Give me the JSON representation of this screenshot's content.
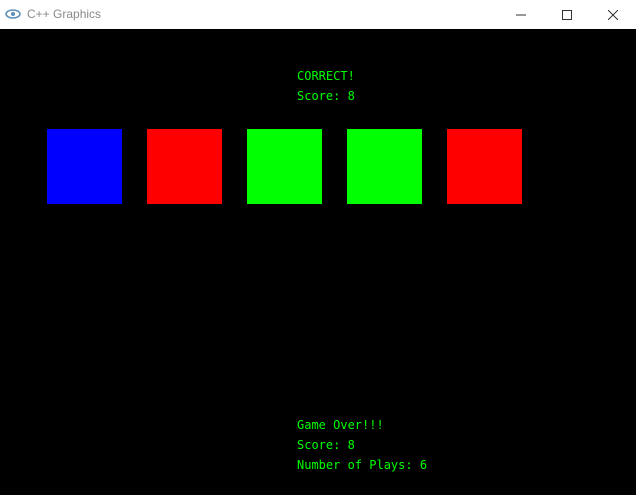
{
  "window": {
    "title": "C++ Graphics",
    "icon": "cpp-graphics-app-icon",
    "controls": [
      "minimize-icon",
      "maximize-icon",
      "close-icon"
    ]
  },
  "game": {
    "status": "CORRECT!",
    "score_line": "Score: 8",
    "squares": [
      {
        "color": "#0000ff"
      },
      {
        "color": "#ff0000"
      },
      {
        "color": "#00ff00"
      },
      {
        "color": "#00ff00"
      },
      {
        "color": "#ff0000"
      }
    ],
    "game_over": "Game Over!!!",
    "final_score": "Score: 8",
    "plays": "Number of Plays: 6"
  },
  "colors": {
    "background": "#000000",
    "text": "#00ff00"
  }
}
